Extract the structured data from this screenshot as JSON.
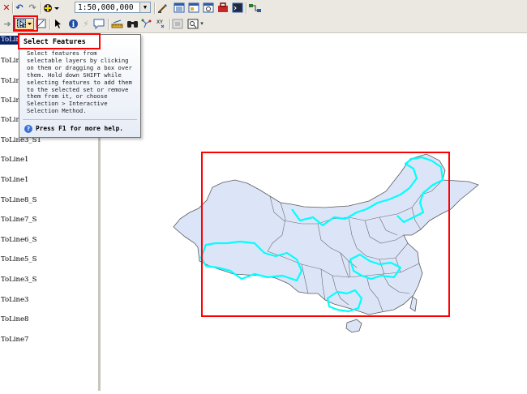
{
  "toolbar": {
    "scale_value": "1:50,000,000",
    "scale_options": [
      "1:50,000,000"
    ]
  },
  "tooltip": {
    "title": "Select Features",
    "body": "Select features from\nselectable layers by clicking\non them or dragging a box over\nthem. Hold down SHIFT while\nselecting features to add them\nto the selected set or remove\nthem from it, or choose\nSelection > Interactive\nSelection Method.",
    "help": "Press F1 for more help."
  },
  "toc": {
    "items": [
      {
        "label": "ToLine",
        "selected": true
      },
      {
        "label": "ToLine",
        "selected": false
      },
      {
        "label": "ToLine",
        "selected": false
      },
      {
        "label": "ToLine",
        "selected": false
      },
      {
        "label": "ToLine5_S1",
        "selected": false
      },
      {
        "label": "ToLine3_S1",
        "selected": false
      },
      {
        "label": "ToLine1",
        "selected": false
      },
      {
        "label": "ToLine1",
        "selected": false
      },
      {
        "label": "ToLine8_S",
        "selected": false
      },
      {
        "label": "ToLine7_S",
        "selected": false
      },
      {
        "label": "ToLine6_S",
        "selected": false
      },
      {
        "label": "ToLine5_S",
        "selected": false
      },
      {
        "label": "ToLine3_S",
        "selected": false
      },
      {
        "label": "ToLine3",
        "selected": false
      },
      {
        "label": "ToLine8",
        "selected": false
      },
      {
        "label": "ToLine7",
        "selected": false
      }
    ]
  },
  "map": {
    "fill_color": "#dce4f8",
    "boundary_color": "#5a5a5a",
    "selected_line_color": "#00ffff",
    "highlight_color": "#ff0000"
  }
}
